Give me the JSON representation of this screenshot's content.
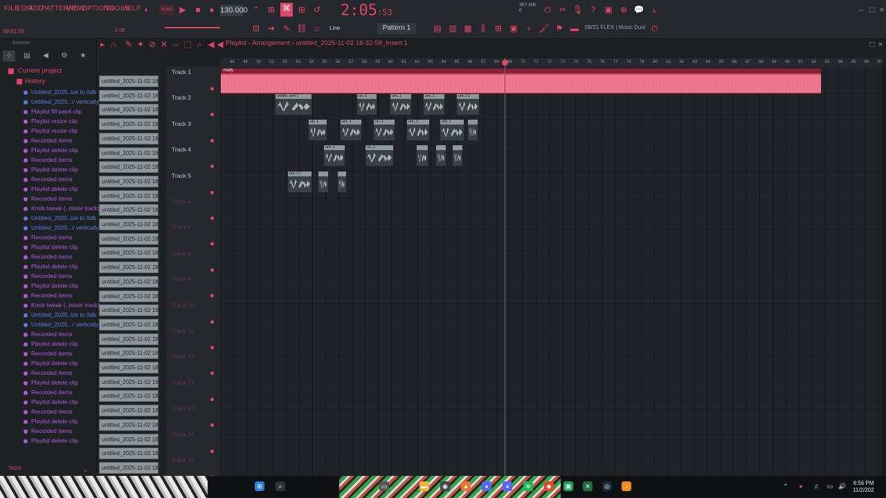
{
  "menu": {
    "items": [
      "FILE",
      "EDIT",
      "ADD",
      "PATTERNS",
      "VIEW",
      "OPTIONS",
      "TOOLS",
      "HELP"
    ]
  },
  "transport": {
    "song_label": "SONG",
    "tempo": "130.000",
    "time_main": "2:05",
    "time_sub": ":53",
    "mem_line1": "367 MB",
    "mem_line2": "0"
  },
  "song_position": "69:01:00",
  "toolbar": {
    "pattern": "Pattern 1",
    "tool_line": "Line",
    "hint": "08/21  FLEX | Moon Dust",
    "zoom": "Z 06'"
  },
  "browser": {
    "title": "Browser",
    "current_project": "Current project",
    "history": "History",
    "tags": "TAGS",
    "history_items": [
      {
        "label": "Untitled_2025..ize to 0db",
        "color": "blue"
      },
      {
        "label": "Untitled_2025...r vertically",
        "color": "blue"
      },
      {
        "label": "Playlist fill paint clip",
        "color": "purple"
      },
      {
        "label": "Playlist resize clip",
        "color": "purple"
      },
      {
        "label": "Playlist resize clip",
        "color": "purple"
      },
      {
        "label": "Recorded items",
        "color": "purple"
      },
      {
        "label": "Playlist delete clip",
        "color": "purple"
      },
      {
        "label": "Recorded items",
        "color": "purple"
      },
      {
        "label": "Playlist delete clip",
        "color": "purple"
      },
      {
        "label": "Recorded items",
        "color": "purple"
      },
      {
        "label": "Playlist delete clip",
        "color": "purple"
      },
      {
        "label": "Recorded items",
        "color": "purple"
      },
      {
        "label": "Knob tweak (..mixer track)",
        "color": "purple"
      },
      {
        "label": "Untitled_2025..ize to 0db",
        "color": "blue"
      },
      {
        "label": "Untitled_2025...r vertically",
        "color": "blue"
      },
      {
        "label": "Recorded items",
        "color": "purple"
      },
      {
        "label": "Playlist delete clip",
        "color": "purple"
      },
      {
        "label": "Recorded items",
        "color": "purple"
      },
      {
        "label": "Playlist delete clip",
        "color": "purple"
      },
      {
        "label": "Recorded items",
        "color": "purple"
      },
      {
        "label": "Playlist delete clip",
        "color": "purple"
      },
      {
        "label": "Recorded items",
        "color": "purple"
      },
      {
        "label": "Knob tweak (..mixer track)",
        "color": "purple"
      },
      {
        "label": "Untitled_2025..ize to 0db",
        "color": "blue"
      },
      {
        "label": "Untitled_2025...r vertically",
        "color": "blue"
      },
      {
        "label": "Recorded items",
        "color": "purple"
      },
      {
        "label": "Playlist delete clip",
        "color": "purple"
      },
      {
        "label": "Recorded items",
        "color": "purple"
      },
      {
        "label": "Playlist delete clip",
        "color": "purple"
      },
      {
        "label": "Recorded items",
        "color": "purple"
      },
      {
        "label": "Playlist delete clip",
        "color": "purple"
      },
      {
        "label": "Recorded items",
        "color": "purple"
      },
      {
        "label": "Playlist delete clip",
        "color": "purple"
      },
      {
        "label": "Recorded items",
        "color": "purple"
      },
      {
        "label": "Playlist delete clip",
        "color": "purple"
      },
      {
        "label": "Recorded items",
        "color": "purple"
      },
      {
        "label": "Playlist delete clip",
        "color": "purple"
      }
    ]
  },
  "channel_label": "untitled_2025-11-02 18-...",
  "playlist": {
    "title": "Playlist - Arrangement",
    "path": "untitled_2025-11-02 18-32-58_Insert 1",
    "tracks": [
      "Track 1",
      "Track 2",
      "Track 3",
      "Track 4",
      "Track 5",
      "Track 6",
      "Track 7",
      "Track 8",
      "Track 9",
      "Track 10",
      "Track 11",
      "Track 12",
      "Track 13",
      "Track 14",
      "Track 15",
      "Track 16"
    ],
    "ruler": [
      "48",
      "49",
      "50",
      "51",
      "52",
      "53",
      "54",
      "55",
      "56",
      "57",
      "58",
      "59",
      "60",
      "61",
      "62",
      "63",
      "64",
      "65",
      "66",
      "67",
      "68",
      "69",
      "70",
      "71",
      "72",
      "73",
      "74",
      "75",
      "76",
      "77",
      "78",
      "79",
      "80",
      "81",
      "82",
      "83",
      "84",
      "85",
      "86",
      "87",
      "88",
      "89",
      "90",
      "91",
      "92",
      "93",
      "94",
      "95",
      "96",
      "97"
    ],
    "main_clip": "mally",
    "small_clips": [
      "untitle..sert 1",
      "un..1",
      "unt..1",
      "unt..1",
      "unt..t 1",
      "un..1",
      "unt..1",
      "un..1",
      "unt..1",
      "unt..1",
      "unt..1",
      "un..1",
      "unt..t 1"
    ]
  },
  "taskbar": {
    "time": "6:56 PM",
    "date": "11/2/202"
  }
}
